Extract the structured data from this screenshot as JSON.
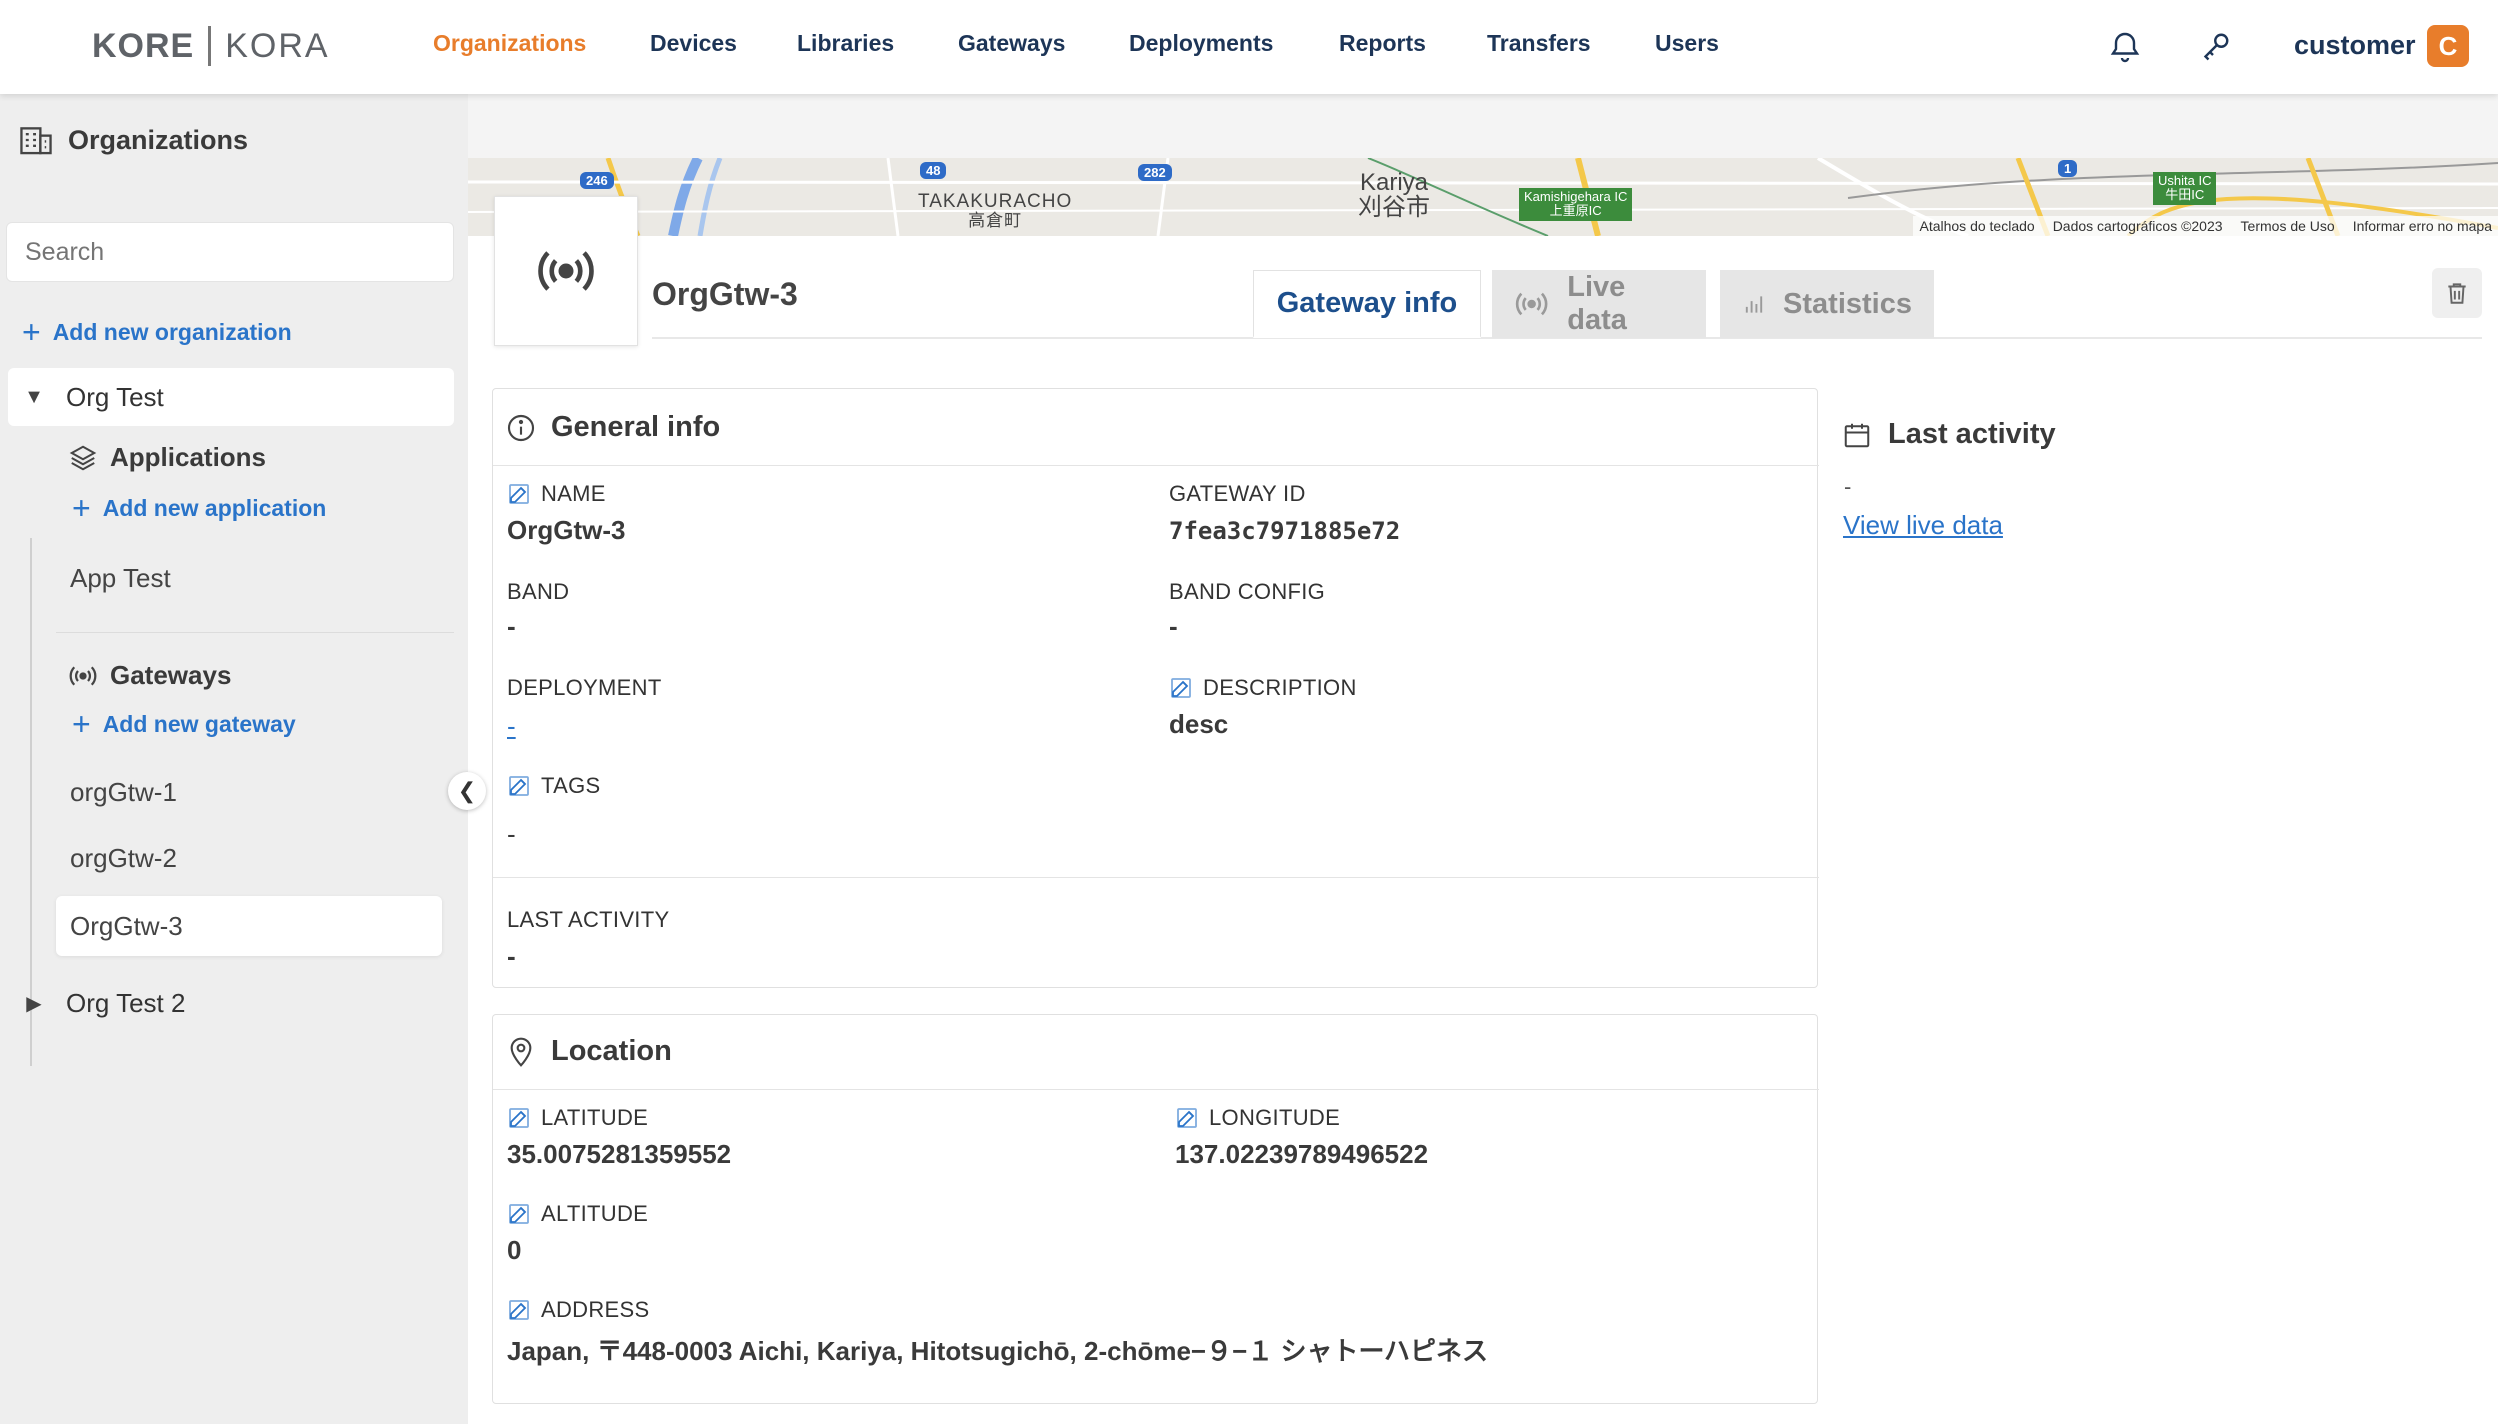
{
  "app": {
    "brand_left": "KORE",
    "brand_right": "KORA"
  },
  "nav": {
    "items": [
      {
        "label": "Organizations",
        "active": true
      },
      {
        "label": "Devices"
      },
      {
        "label": "Libraries"
      },
      {
        "label": "Gateways"
      },
      {
        "label": "Deployments"
      },
      {
        "label": "Reports"
      },
      {
        "label": "Transfers"
      },
      {
        "label": "Users"
      }
    ],
    "user": {
      "name": "customer",
      "initial": "C"
    },
    "icons": [
      "bell-icon",
      "key-icon"
    ]
  },
  "sidebar": {
    "title": "Organizations",
    "search_placeholder": "Search",
    "add_org_label": "Add new organization",
    "orgs": [
      {
        "name": "Org Test",
        "expanded": true,
        "applications_label": "Applications",
        "add_application_label": "Add new application",
        "applications": [
          "App Test"
        ],
        "gateways_label": "Gateways",
        "add_gateway_label": "Add new gateway",
        "gateways": [
          "orgGtw-1",
          "orgGtw-2",
          "OrgGtw-3"
        ],
        "selected_gateway": "OrgGtw-3"
      },
      {
        "name": "Org Test 2",
        "expanded": false
      }
    ]
  },
  "map": {
    "labels": {
      "takakuracho": "TAKAKURACHO",
      "takakuracho_jp": "高倉町",
      "kariya": "Kariya",
      "kariya_jp": "刈谷市",
      "kamishigehara": "Kamishigehara IC",
      "kamishigehara_jp": "上重原IC",
      "ushita": "Ushita IC",
      "ushita_jp": "牛田IC"
    },
    "route_badges": [
      "246",
      "48",
      "282",
      "1"
    ],
    "footer": [
      "Atalhos do teclado",
      "Dados cartográficos ©2023",
      "Termos de Uso",
      "Informar erro no mapa"
    ]
  },
  "gateway": {
    "title": "OrgGtw-3",
    "tabs": [
      {
        "label": "Gateway info",
        "active": true,
        "icon": ""
      },
      {
        "label": "Live data",
        "active": false,
        "icon": "broadcast-icon"
      },
      {
        "label": "Statistics",
        "active": false,
        "icon": "bar-chart-icon"
      }
    ]
  },
  "general_info": {
    "title": "General info",
    "name_label": "NAME",
    "name_value": "OrgGtw-3",
    "gateway_id_label": "GATEWAY ID",
    "gateway_id_value": "7fea3c7971885e72",
    "band_label": "BAND",
    "band_value": "-",
    "band_config_label": "BAND CONFIG",
    "band_config_value": "-",
    "deployment_label": "DEPLOYMENT",
    "deployment_value": "-",
    "description_label": "DESCRIPTION",
    "description_value": "desc",
    "tags_label": "TAGS",
    "tags_value": "-",
    "last_activity_label": "LAST ACTIVITY",
    "last_activity_value": "-"
  },
  "location": {
    "title": "Location",
    "latitude_label": "LATITUDE",
    "latitude_value": "35.0075281359552",
    "longitude_label": "LONGITUDE",
    "longitude_value": "137.02239789496522",
    "altitude_label": "ALTITUDE",
    "altitude_value": "0",
    "address_label": "ADDRESS",
    "address_value": "Japan, 〒448-0003 Aichi, Kariya, Hitotsugichō, 2-chōme−９−１ シャトーハピネス"
  },
  "last_activity_panel": {
    "title": "Last activity",
    "value": "-",
    "link": "View live data"
  },
  "colors": {
    "accent": "#e87d2b",
    "link": "#2a74c9",
    "navy": "#1d3557"
  }
}
